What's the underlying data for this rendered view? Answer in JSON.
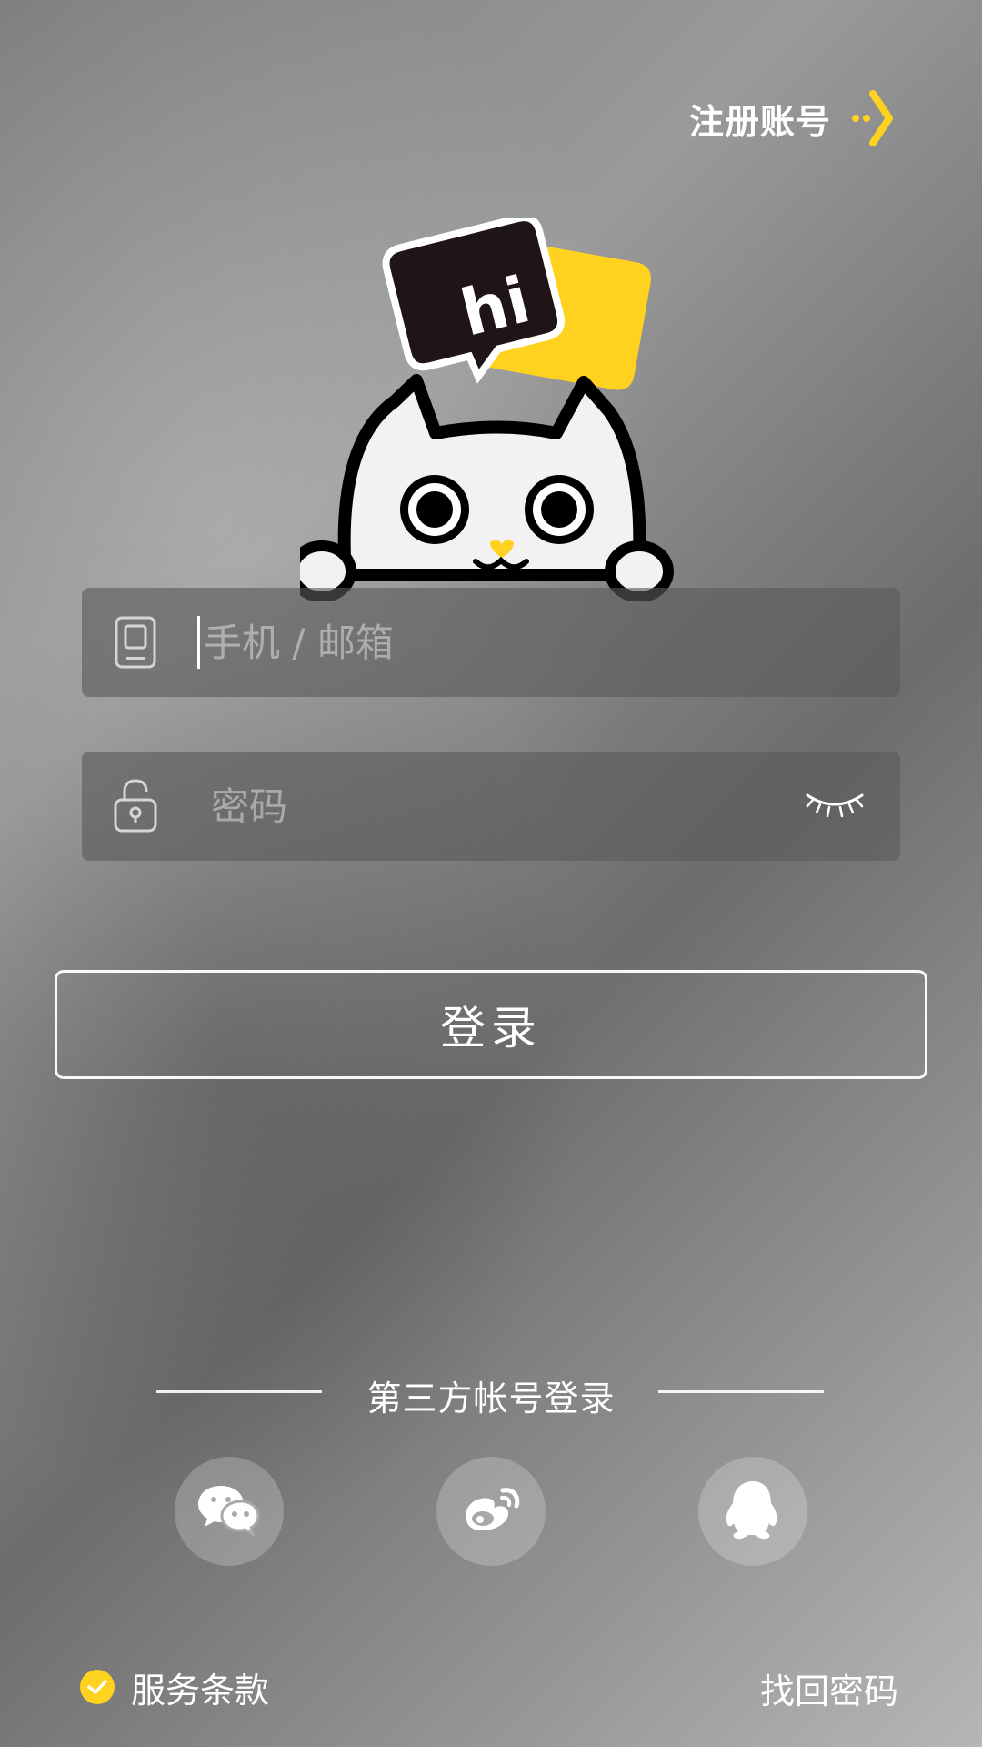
{
  "header": {
    "register_label": "注册账号"
  },
  "brand": {
    "badge_text": "hi"
  },
  "account_field": {
    "placeholder": "手机 / 邮箱",
    "value": ""
  },
  "password_field": {
    "placeholder": "密码",
    "value": ""
  },
  "login_button": {
    "label": "登录"
  },
  "third_party": {
    "title": "第三方帐号登录",
    "items": [
      {
        "name": "wechat",
        "icon": "wechat-icon"
      },
      {
        "name": "weibo",
        "icon": "weibo-icon"
      },
      {
        "name": "qq",
        "icon": "qq-icon"
      }
    ]
  },
  "footer": {
    "terms_label": "服务条款",
    "forgot_label": "找回密码"
  },
  "colors": {
    "accent": "#ffd21f",
    "text": "#ffffff",
    "field_bg": "#5a5a5a"
  }
}
